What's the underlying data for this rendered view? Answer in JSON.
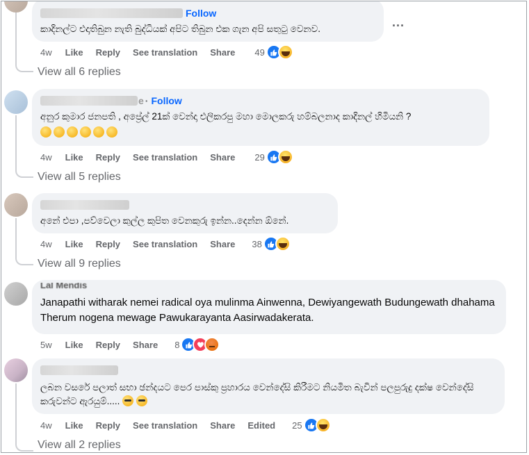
{
  "more_label": "...",
  "comments": [
    {
      "follow": "Follow",
      "text": "කාදිනල්ට එදාතිබුන නැති බුද්ධියක් අපිට තිබුන එක ගැන අපි සතුටු වෙනව.",
      "time": "4w",
      "like": "Like",
      "reply": "Reply",
      "translate": "See translation",
      "share": "Share",
      "reaction_count": "49",
      "view_replies": "View all 6 replies"
    },
    {
      "follow": "Follow",
      "name_suffix": "e",
      "dot": "·",
      "text": "අනුර කුමාර ජනපති , අප්‍රේල් 21ක් වෙන්දා එලිකරපු මහා මොලකරු හම්බලනාද කාදිනල් හිමියනි ?",
      "emojis": [
        "😥",
        "🤣",
        "😂",
        "😁",
        "🥹",
        "😌"
      ],
      "time": "4w",
      "like": "Like",
      "reply": "Reply",
      "translate": "See translation",
      "share": "Share",
      "reaction_count": "29",
      "view_replies": "View all 5 replies"
    },
    {
      "text": "අනේ එපා ,පව්වෙලා කුල්ල කුපිත වෙනකුරු ඉන්න..දෙන්න ඕනේ.",
      "time": "4w",
      "like": "Like",
      "reply": "Reply",
      "translate": "See translation",
      "share": "Share",
      "reaction_count": "38",
      "view_replies": "View all 9 replies"
    },
    {
      "name": "Lal Mendis",
      "text": "Janapathi witharak nemei radical oya mulinma Ainwenna, Dewiyangewath Budungewath dhahama Therum nogena mewage Pawukarayanta Aasirwadakerata.",
      "time": "5w",
      "like": "Like",
      "reply": "Reply",
      "share": "Share",
      "reaction_count": "8"
    },
    {
      "text": "ලබන වසරේ පලාත් සභා ඡන්දයට පෙර පාස්කු ප්‍රහාරය වෙන්දේසි කිරීමට නියමිත බැවින් පලපුරුදු දක්ෂ වෙන්දේසි කරුවන්ට ඇරයුම්.....",
      "emojis": [
        "😎",
        "😎"
      ],
      "time": "4w",
      "like": "Like",
      "reply": "Reply",
      "translate": "See translation",
      "share": "Share",
      "edited": "Edited",
      "reaction_count": "25",
      "view_replies": "View all 2 replies"
    }
  ],
  "colors": {
    "link": "#0866ff",
    "bubble": "#f0f2f5",
    "meta": "#65676b",
    "like_blue": "#1877f2",
    "love_red": "#f33e58"
  }
}
